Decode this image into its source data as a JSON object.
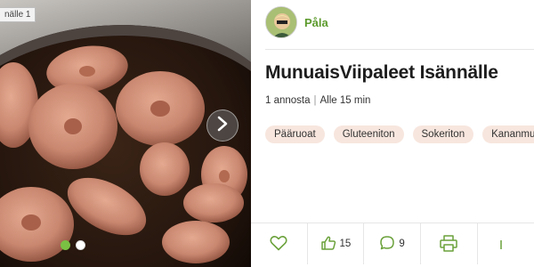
{
  "carousel": {
    "image_label": "nälle 1",
    "slide_count": 2,
    "active_slide": 1
  },
  "author": {
    "name": "Påla"
  },
  "recipe": {
    "title": "MunuaisViipaleet Isännälle",
    "servings": "1 annosta",
    "time": "Alle 15 min",
    "tags": [
      "Pääruoat",
      "Gluteeniton",
      "Sokeriton",
      "Kananmu"
    ]
  },
  "actions": {
    "likes": "15",
    "comments": "9"
  },
  "icons": [
    "chevron-right-icon",
    "heart-icon",
    "thumbs-up-icon",
    "comment-icon",
    "print-icon"
  ],
  "colors": {
    "accent_green": "#7ac043",
    "author_green": "#5c9a2c",
    "tag_bg": "#f7e6de"
  }
}
